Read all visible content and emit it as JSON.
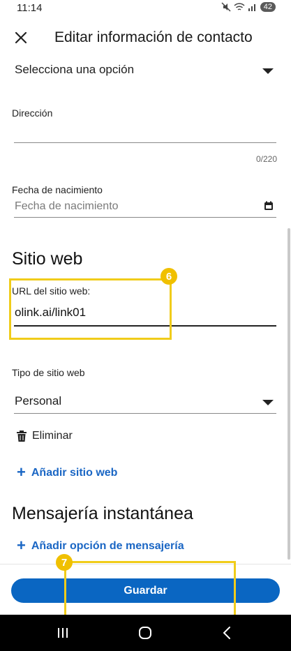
{
  "status": {
    "time": "11:14",
    "battery": "42"
  },
  "header": {
    "title": "Editar información de contacto"
  },
  "form": {
    "select_placeholder": "Selecciona una opción",
    "address_label": "Dirección",
    "address_counter": "0/220",
    "birthdate_label": "Fecha de nacimiento",
    "birthdate_placeholder": "Fecha de nacimiento"
  },
  "website_section": {
    "title": "Sitio web",
    "url_label": "URL del sitio web:",
    "url_value": "olink.ai/link01",
    "type_label": "Tipo de sitio web",
    "type_value": "Personal",
    "delete_label": "Eliminar",
    "add_label": "Añadir sitio web"
  },
  "messaging_section": {
    "title": "Mensajería instantánea",
    "add_label": "Añadir opción de mensajería"
  },
  "footer": {
    "save_label": "Guardar"
  },
  "annotations": {
    "badge_1": "6",
    "badge_2": "7"
  },
  "colors": {
    "accent": "#0a66c2",
    "highlight": "#f0cc1a"
  }
}
